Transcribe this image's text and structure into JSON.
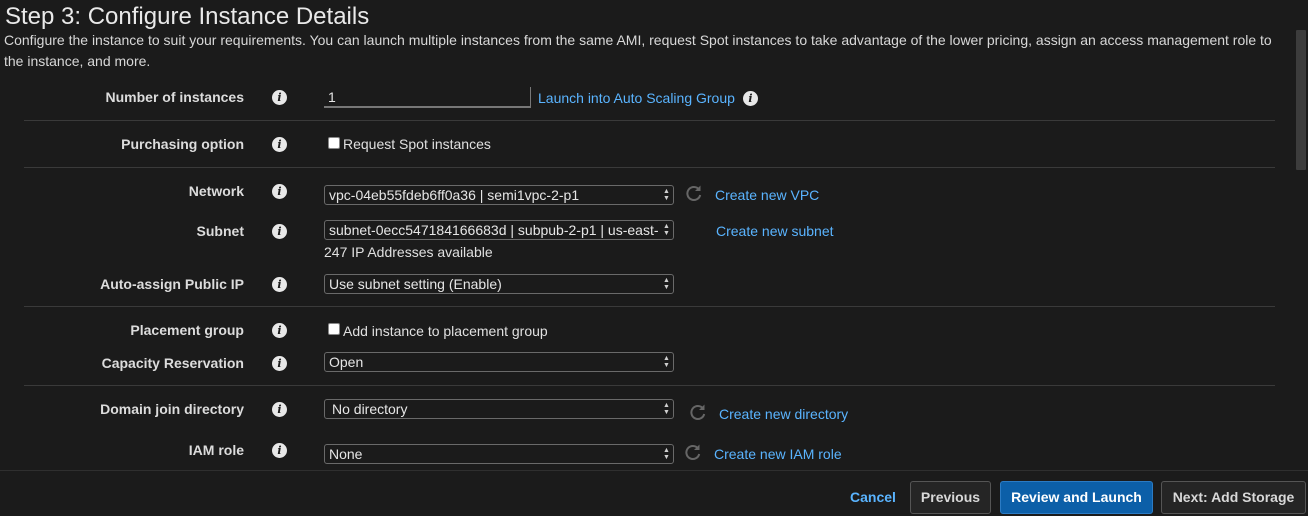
{
  "page": {
    "title": "Step 3: Configure Instance Details",
    "description": "Configure the instance to suit your requirements. You can launch multiple instances from the same AMI, request Spot instances to take advantage of the lower pricing, assign an access management role to the instance, and more."
  },
  "form": {
    "number_of_instances": {
      "label": "Number of instances",
      "value": "1",
      "link": "Launch into Auto Scaling Group"
    },
    "purchasing_option": {
      "label": "Purchasing option",
      "checkbox_label": "Request Spot instances",
      "checked": false
    },
    "network": {
      "label": "Network",
      "selected": "vpc-04eb55fdeb6ff0a36 | semi1vpc-2-p1",
      "link": "Create new VPC"
    },
    "subnet": {
      "label": "Subnet",
      "selected": "subnet-0ecc547184166683d | subpub-2-p1 | us-east-",
      "available": "247 IP Addresses available",
      "link": "Create new subnet"
    },
    "auto_assign_public_ip": {
      "label": "Auto-assign Public IP",
      "selected": "Use subnet setting (Enable)"
    },
    "placement_group": {
      "label": "Placement group",
      "checkbox_label": "Add instance to placement group",
      "checked": false
    },
    "capacity_reservation": {
      "label": "Capacity Reservation",
      "selected": "Open"
    },
    "domain_join_directory": {
      "label": "Domain join directory",
      "selected": "No directory",
      "link": "Create new directory"
    },
    "iam_role": {
      "label": "IAM role",
      "selected": "None",
      "link": "Create new IAM role"
    }
  },
  "footer": {
    "cancel": "Cancel",
    "previous": "Previous",
    "review_and_launch": "Review and Launch",
    "next": "Next: Add Storage"
  },
  "icons": {
    "info": "info-icon",
    "refresh": "refresh-icon",
    "select_arrow": "chevron-updown-icon"
  },
  "colors": {
    "background": "#1b1b1b",
    "link": "#5ab4ff",
    "primary_button": "#0c5fa8"
  }
}
